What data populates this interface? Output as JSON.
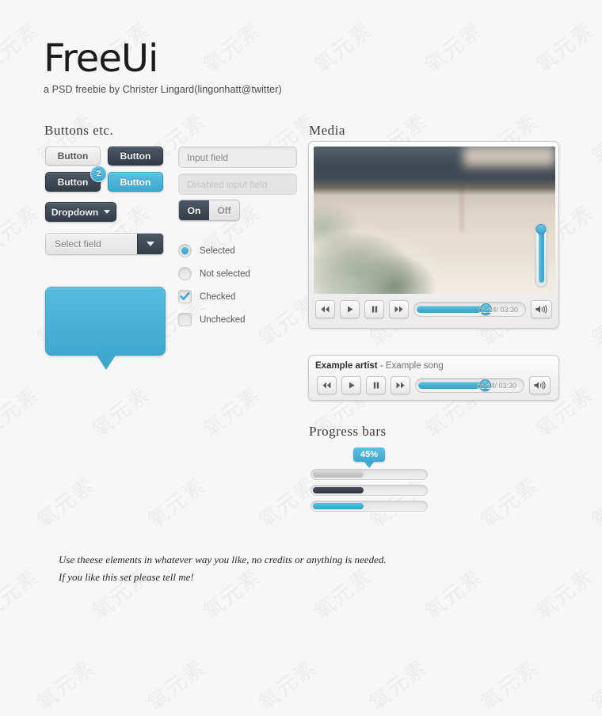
{
  "header": {
    "logo": "FreeUi",
    "tagline": "a PSD freebie by Christer Lingard(lingonhatt@twitter)"
  },
  "sections": {
    "buttons_title": "Buttons etc.",
    "media_title": "Media",
    "progress_title": "Progress bars"
  },
  "buttons": {
    "light": "Button",
    "dark": "Button",
    "dark_badged": "Button",
    "badge_count": "2",
    "blue": "Button",
    "dropdown": "Dropdown",
    "select_field": "Select field"
  },
  "inputs": {
    "input_placeholder": "Input field",
    "disabled_placeholder": "Disabled input field"
  },
  "toggle": {
    "on": "On",
    "off": "Off"
  },
  "options": [
    {
      "type": "radio",
      "state": "selected",
      "label": "Selected"
    },
    {
      "type": "radio",
      "state": "unselected",
      "label": "Not selected"
    },
    {
      "type": "checkbox",
      "state": "checked",
      "label": "Checked"
    },
    {
      "type": "checkbox",
      "state": "unchecked",
      "label": "Unchecked"
    }
  ],
  "video_player": {
    "time": "01:24/ 03:30",
    "progress_percent": 62,
    "volume_percent": 88,
    "controls": [
      "rewind-icon",
      "play-icon",
      "pause-icon",
      "forward-icon"
    ],
    "volume_icon": "volume-icon"
  },
  "audio_player": {
    "artist": "Example artist",
    "separator": "-",
    "song": "Example song",
    "time": "01:24/ 03:30",
    "progress_percent": 62,
    "controls": [
      "rewind-icon",
      "play-icon",
      "pause-icon",
      "forward-icon"
    ],
    "volume_icon": "volume-icon"
  },
  "progress": {
    "tooltip": "45%",
    "bars": [
      {
        "style": "grey",
        "percent": 45
      },
      {
        "style": "dark",
        "percent": 45
      },
      {
        "style": "blue",
        "percent": 45
      }
    ]
  },
  "footer": {
    "line1": "Use theese elements in whatever way you like, no credits or anything is needed.",
    "line2": "If you like this set please tell me!"
  },
  "colors": {
    "accent_blue": "#3fa8ce",
    "dark_slate": "#3d4752",
    "page_bg": "#f7f7f7"
  },
  "watermark_text": "氧元素"
}
